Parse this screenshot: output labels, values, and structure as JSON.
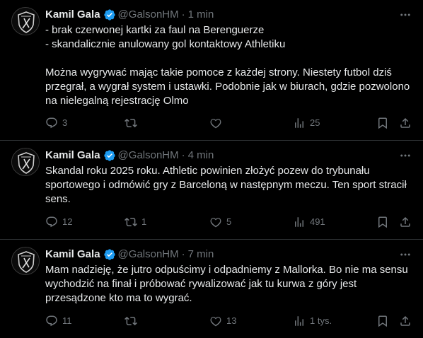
{
  "icons": {
    "avatar": "club-crest-avatar",
    "verified": "verified-badge-icon",
    "more": "more-options-icon",
    "reply": "reply-icon",
    "retweet": "retweet-icon",
    "like": "like-icon",
    "views": "views-icon",
    "bookmark": "bookmark-icon",
    "share": "share-icon"
  },
  "colors": {
    "background": "#000000",
    "text": "#e7e9ea",
    "muted": "#71767b",
    "verified": "#1d9bf0",
    "divider": "#2f3336"
  },
  "tweets": [
    {
      "name": "Kamil Gala",
      "handle": "@GalsonHM",
      "dot": "·",
      "time": "1 min",
      "text": "- brak czerwonej kartki za faul na Berenguerze\n- skandalicznie anulowany gol kontaktowy Athletiku\n\nMożna wygrywać mając takie pomoce z każdej strony. Niestety futbol dziś przegrał, a wygrał system i ustawki. Podobnie jak w biurach, gdzie pozwolono na nielegalną rejestrację Olmo",
      "replies": "3",
      "retweets": "",
      "likes": "",
      "views": "25"
    },
    {
      "name": "Kamil Gala",
      "handle": "@GalsonHM",
      "dot": "·",
      "time": "4 min",
      "text": "Skandal roku 2025 roku. Athletic powinien złożyć pozew do trybunału sportowego i odmówić gry z Barceloną w następnym meczu. Ten sport stracił sens.",
      "replies": "12",
      "retweets": "1",
      "likes": "5",
      "views": "491"
    },
    {
      "name": "Kamil Gala",
      "handle": "@GalsonHM",
      "dot": "·",
      "time": "7 min",
      "text": "Mam nadzieję, że jutro odpuścimy i odpadniemy z Mallorka. Bo nie ma sensu wychodzić na finał i próbować rywalizować jak tu kurwa z góry jest przesądzone kto ma to wygrać.",
      "replies": "11",
      "retweets": "",
      "likes": "13",
      "views": "1 tys."
    }
  ]
}
